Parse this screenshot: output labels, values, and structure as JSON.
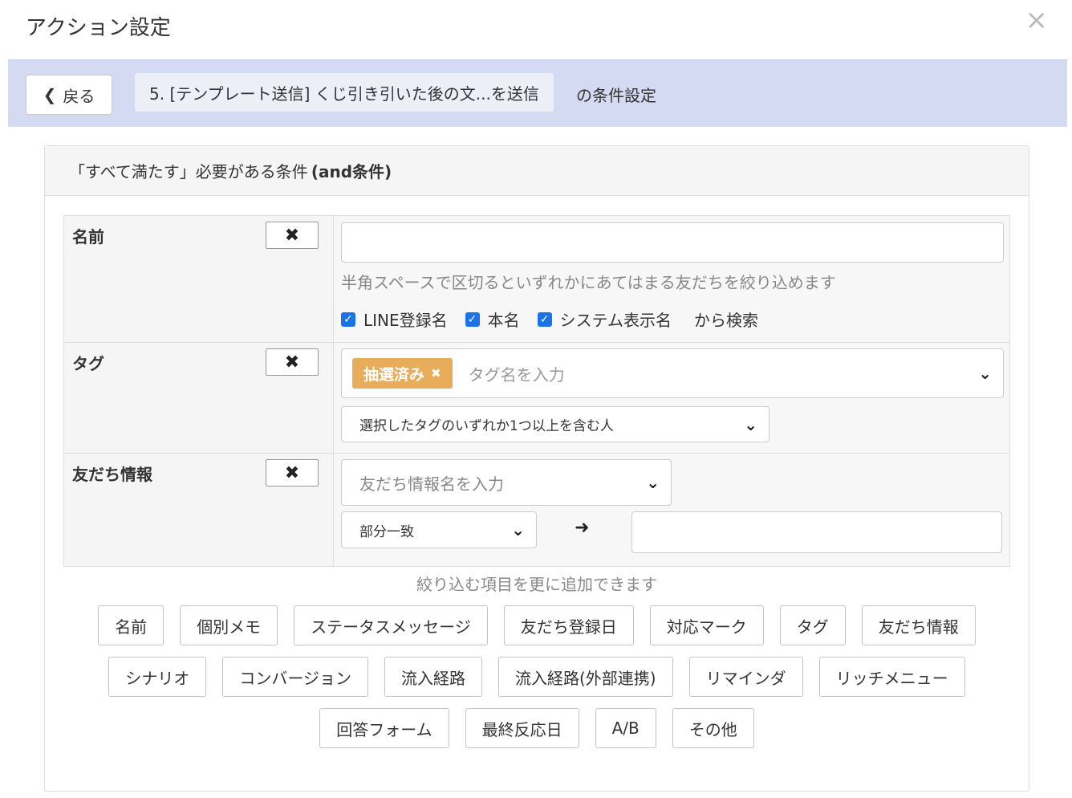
{
  "modal": {
    "title": "アクション設定",
    "close": "×"
  },
  "header": {
    "back_label": "戻る",
    "breadcrumb": "5. [テンプレート送信] くじ引き引いた後の文...を送信",
    "suffix": "の条件設定"
  },
  "panel": {
    "heading_prefix": "「すべて満たす」必要がある条件",
    "heading_bold": "(and条件)"
  },
  "conditions": {
    "name": {
      "label": "名前",
      "remove": "✖",
      "input_value": "",
      "hint": "半角スペースで区切るといずれかにあてはまる友だちを絞り込めます",
      "checks": [
        {
          "label": "LINE登録名",
          "checked": true
        },
        {
          "label": "本名",
          "checked": true
        },
        {
          "label": "システム表示名",
          "checked": true
        }
      ],
      "search_suffix": "から検索"
    },
    "tag": {
      "label": "タグ",
      "remove": "✖",
      "chip": "抽選済み",
      "chip_remove": "✖",
      "placeholder": "タグ名を入力",
      "condition": "選択したタグのいずれか1つ以上を含む人",
      "chip_color": "#e8ad5a"
    },
    "friend_info": {
      "label": "友だち情報",
      "remove": "✖",
      "placeholder": "友だち情報名を入力",
      "match": "部分一致",
      "value": ""
    }
  },
  "add_section": {
    "hint": "絞り込む項目を更に追加できます",
    "rows": [
      [
        "名前",
        "個別メモ",
        "ステータスメッセージ",
        "友だち登録日",
        "対応マーク",
        "タグ",
        "友だち情報"
      ],
      [
        "シナリオ",
        "コンバージョン",
        "流入経路",
        "流入経路(外部連携)",
        "リマインダ",
        "リッチメニュー"
      ],
      [
        "回答フォーム",
        "最終反応日",
        "A/B",
        "その他"
      ]
    ]
  },
  "colors": {
    "header_bg": "#d3daf2",
    "checkbox": "#1a73e8"
  }
}
